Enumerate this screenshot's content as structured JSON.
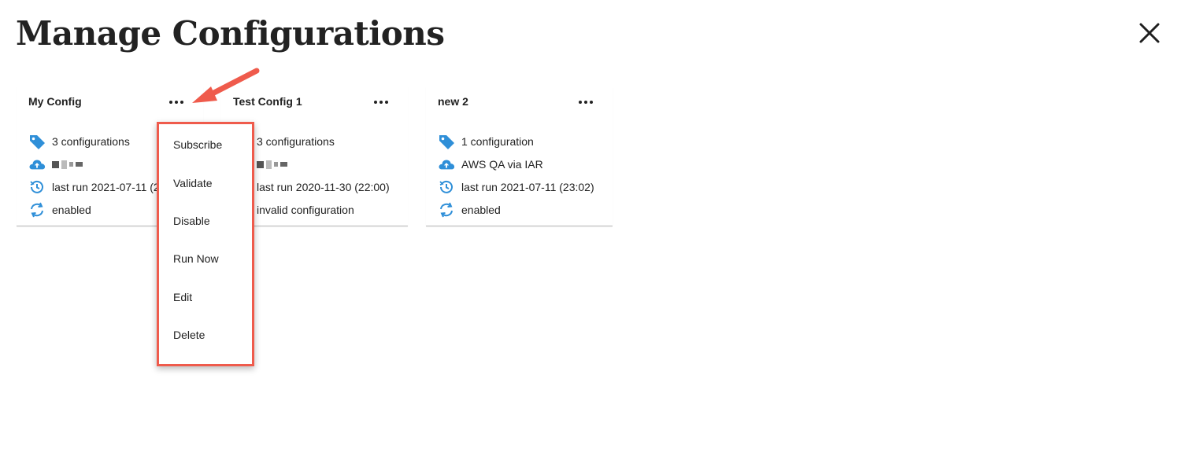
{
  "page": {
    "title": "Manage Configurations"
  },
  "colors": {
    "accent_icon": "#2f8fd8",
    "annotation": "#ef5b4c"
  },
  "cards": [
    {
      "title": "My Config",
      "configurations": "3 configurations",
      "destination": "",
      "last_run": "last run 2021-07-11 (2",
      "status": "enabled"
    },
    {
      "title": "Test Config 1",
      "configurations": "3 configurations",
      "destination": "",
      "last_run": "last run 2020-11-30 (22:00)",
      "status": "invalid configuration"
    },
    {
      "title": "new 2",
      "configurations": "1 configuration",
      "destination": "AWS QA via IAR",
      "last_run": "last run 2021-07-11 (23:02)",
      "status": "enabled"
    }
  ],
  "menu": {
    "items": [
      "Subscribe",
      "Validate",
      "Disable",
      "Run Now",
      "Edit",
      "Delete"
    ]
  },
  "icons": {
    "close": "close-icon",
    "more": "more-horizontal-icon",
    "tag": "tag-icon",
    "cloud_upload": "cloud-upload-icon",
    "history": "clock-history-icon",
    "sync": "sync-icon"
  }
}
